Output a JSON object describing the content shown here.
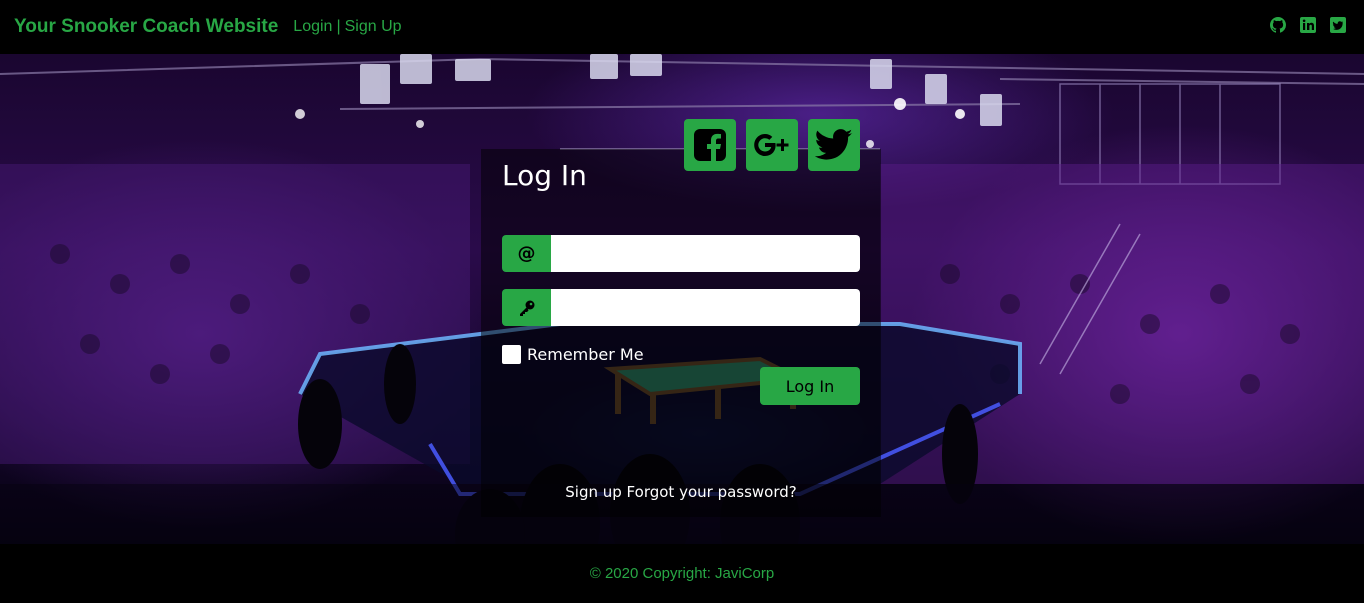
{
  "navbar": {
    "brand": "Your Snooker Coach Website",
    "login_label": "Login",
    "separator": "|",
    "signup_label": "Sign Up",
    "icons": [
      "github-icon",
      "linkedin-icon",
      "twitter-icon"
    ],
    "accent_color": "#28a745"
  },
  "login_card": {
    "title": "Log In",
    "social_buttons": [
      {
        "name": "facebook",
        "icon": "facebook-icon"
      },
      {
        "name": "google-plus",
        "icon": "google-plus-icon",
        "label": "G+"
      },
      {
        "name": "twitter",
        "icon": "twitter-icon"
      }
    ],
    "email_prepend": "@",
    "email_value": "",
    "password_value": "",
    "remember_label": "Remember Me",
    "remember_checked": false,
    "login_button": "Log In",
    "signup_link": "Sign up",
    "forgot_link": "Forgot your password?"
  },
  "footer": {
    "copyright": "© 2020 Copyright: JaviCorp"
  }
}
